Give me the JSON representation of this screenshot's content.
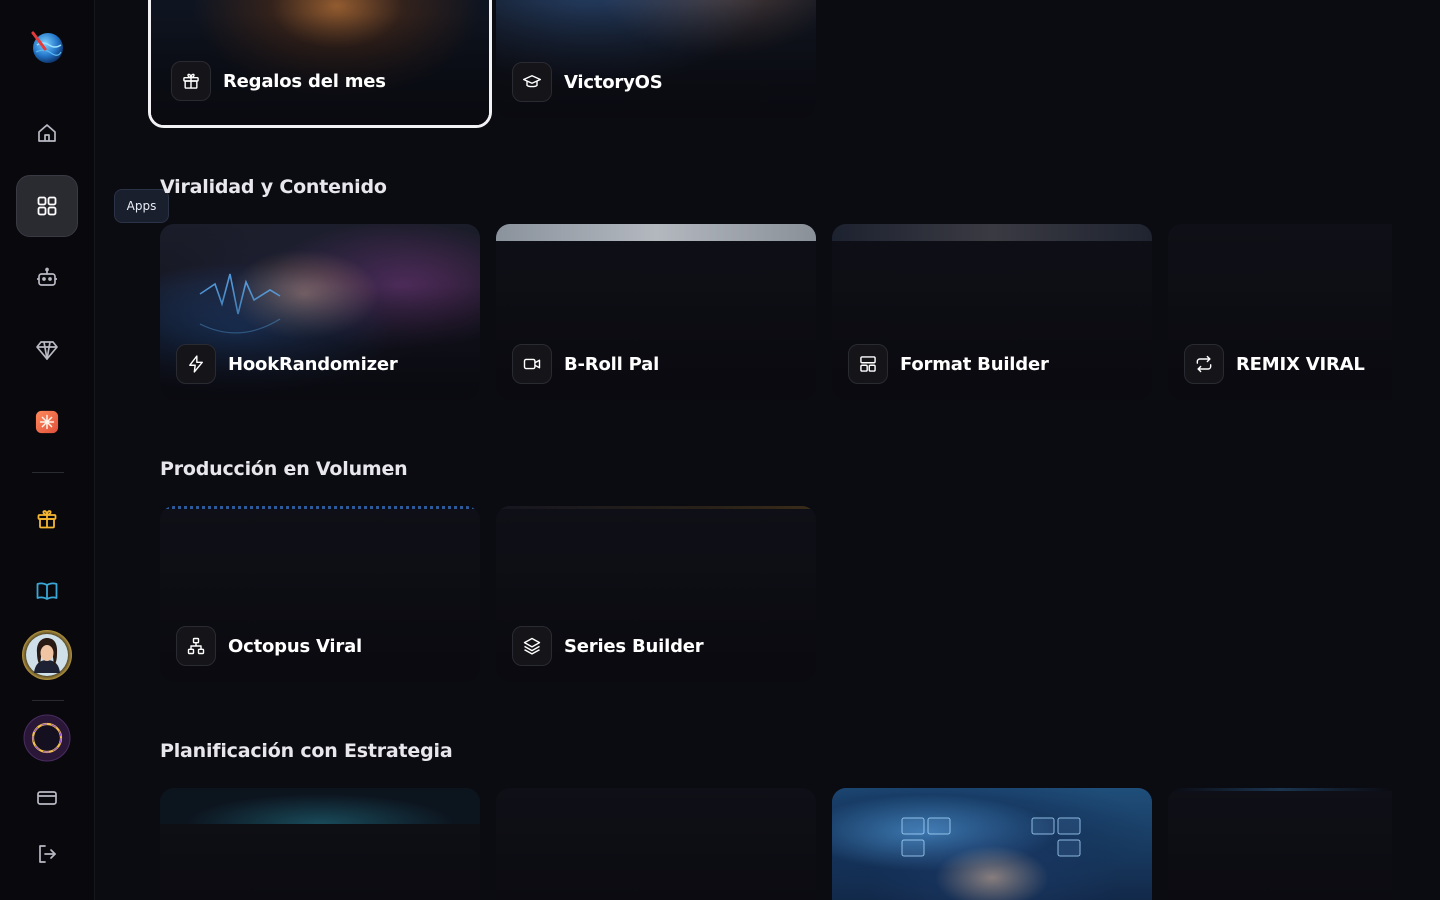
{
  "sidebar": {
    "items": [
      {
        "icon": "home-icon",
        "active": false
      },
      {
        "icon": "apps-grid-icon",
        "active": true
      },
      {
        "icon": "robot-icon",
        "active": false
      },
      {
        "icon": "diamond-icon",
        "active": false
      },
      {
        "icon": "spark-app-icon",
        "active": false
      },
      {
        "icon": "gift-icon",
        "active": false
      },
      {
        "icon": "book-icon",
        "active": false
      },
      {
        "icon": "avatar",
        "active": false
      },
      {
        "icon": "ring-icon",
        "active": false
      },
      {
        "icon": "card-icon",
        "active": false
      },
      {
        "icon": "logout-icon",
        "active": false
      }
    ],
    "tooltip": "Apps",
    "accent_gift": "#f5b731",
    "accent_book": "#3aa7d6"
  },
  "top": {
    "cards": [
      {
        "name": "Regalos del mes",
        "icon": "gift-icon"
      },
      {
        "name": "VictoryOS",
        "icon": "graduation-cap-icon"
      }
    ]
  },
  "sections": [
    {
      "title": "Viralidad y Contenido",
      "cards": [
        {
          "name": "HookRandomizer",
          "icon": "lightning-icon"
        },
        {
          "name": "B-Roll Pal",
          "icon": "video-camera-icon"
        },
        {
          "name": "Format Builder",
          "icon": "layout-icon"
        },
        {
          "name": "REMIX VIRAL",
          "icon": "repeat-icon"
        }
      ]
    },
    {
      "title": "Producción en Volumen",
      "cards": [
        {
          "name": "Octopus Viral",
          "icon": "hierarchy-icon"
        },
        {
          "name": "Series Builder",
          "icon": "layers-icon"
        }
      ]
    },
    {
      "title": "Planificación con Estrategia",
      "cards": []
    }
  ]
}
